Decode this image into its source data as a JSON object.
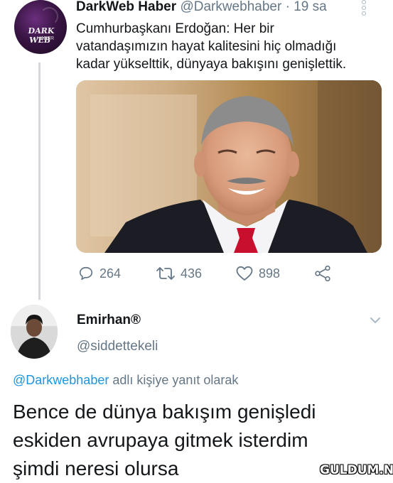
{
  "tweet": {
    "avatar": {
      "logo_text": "DARK WEB",
      "logo_sub": "HABER"
    },
    "author_name": "DarkWeb Haber",
    "handle": "@Darkwebhaber",
    "separator": "·",
    "time": "19 sa",
    "text_lines": [
      "Cumhurbaşkanı Erdoğan: Her bir",
      "vatandaşımızın hayat kalitesini hiç olmadığı",
      "kadar yükselttik, dünyaya bakışını genişlettik."
    ],
    "actions": {
      "reply_count": "264",
      "retweet_count": "436",
      "like_count": "898"
    }
  },
  "reply": {
    "author_name": "Emirhan",
    "name_badge": "®",
    "handle": "@siddettekeli",
    "reply_to_mention": "@Darkwebhaber",
    "reply_to_suffix": " adlı kişiye yanıt olarak",
    "text_lines": [
      "Bence de dünya bakışım genişledi",
      "eskiden avrupaya gitmek isterdim",
      "şimdi neresi olursa"
    ]
  },
  "watermark": "GULDUM.NET",
  "colors": {
    "text": "#14171a",
    "secondary": "#657786",
    "link": "#1b95e0",
    "divider": "#d4d8dc",
    "tie": "#c8102e"
  }
}
